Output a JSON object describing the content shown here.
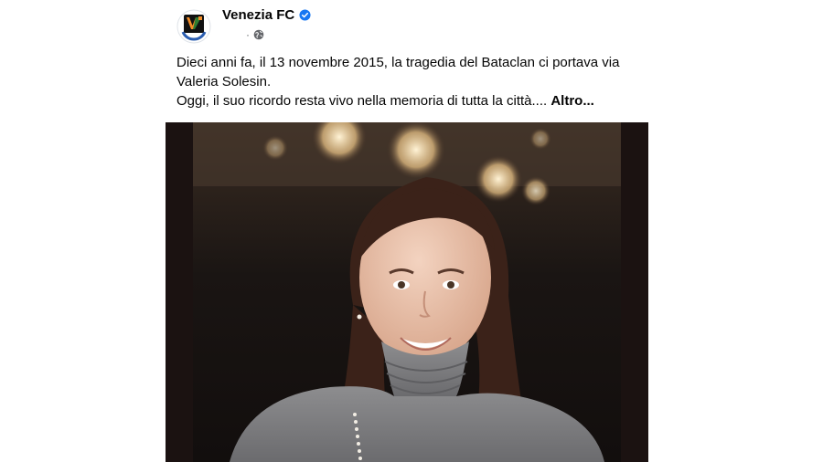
{
  "post": {
    "page_name": "Venezia FC",
    "verified_icon": "verified-badge-icon",
    "privacy_icon": "globe-icon",
    "separator": "·",
    "caption_line_1": "Dieci anni fa, il 13 novembre 2015, la tragedia del Bataclan ci portava via Valeria Solesin.",
    "caption_line_2": "Oggi, il suo ricordo resta vivo nella memoria di tutta la città....",
    "see_more_label": "Altro...",
    "colors": {
      "verified": "#1877f2",
      "text": "#050505",
      "secondary_text": "#65676b",
      "logo_green": "#2e7d32",
      "logo_orange": "#f28c28",
      "logo_black": "#111111"
    }
  }
}
